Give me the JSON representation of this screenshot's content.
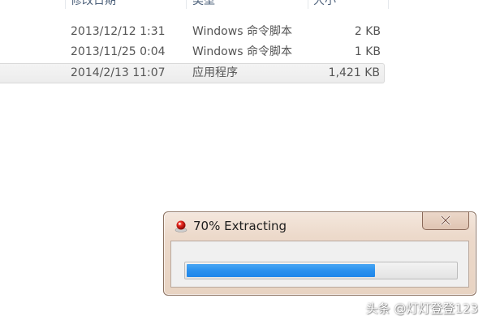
{
  "explorer": {
    "columns": {
      "date_modified": "修改日期",
      "type": "类型",
      "size": "大小"
    },
    "files": [
      {
        "date": "2013/12/12 1:31",
        "type": "Windows 命令脚本",
        "size": "2 KB",
        "selected": false
      },
      {
        "date": "2013/11/25 0:04",
        "type": "Windows 命令脚本",
        "size": "1 KB",
        "selected": false
      },
      {
        "date": "2014/2/13 11:07",
        "type": "应用程序",
        "size": "1,421 KB",
        "selected": true
      }
    ]
  },
  "dialog": {
    "title": "70% Extracting",
    "icon": "red-dot-app-icon",
    "close_icon": "close-x-icon",
    "progress": 0.7,
    "progress_color": "#2b91ee"
  },
  "watermark": {
    "text": "头条 @灯灯登登123"
  },
  "colors": {
    "dialog_frame": "#e8d3c2",
    "selected_row": "#ececec",
    "header_text": "#4c607a"
  }
}
